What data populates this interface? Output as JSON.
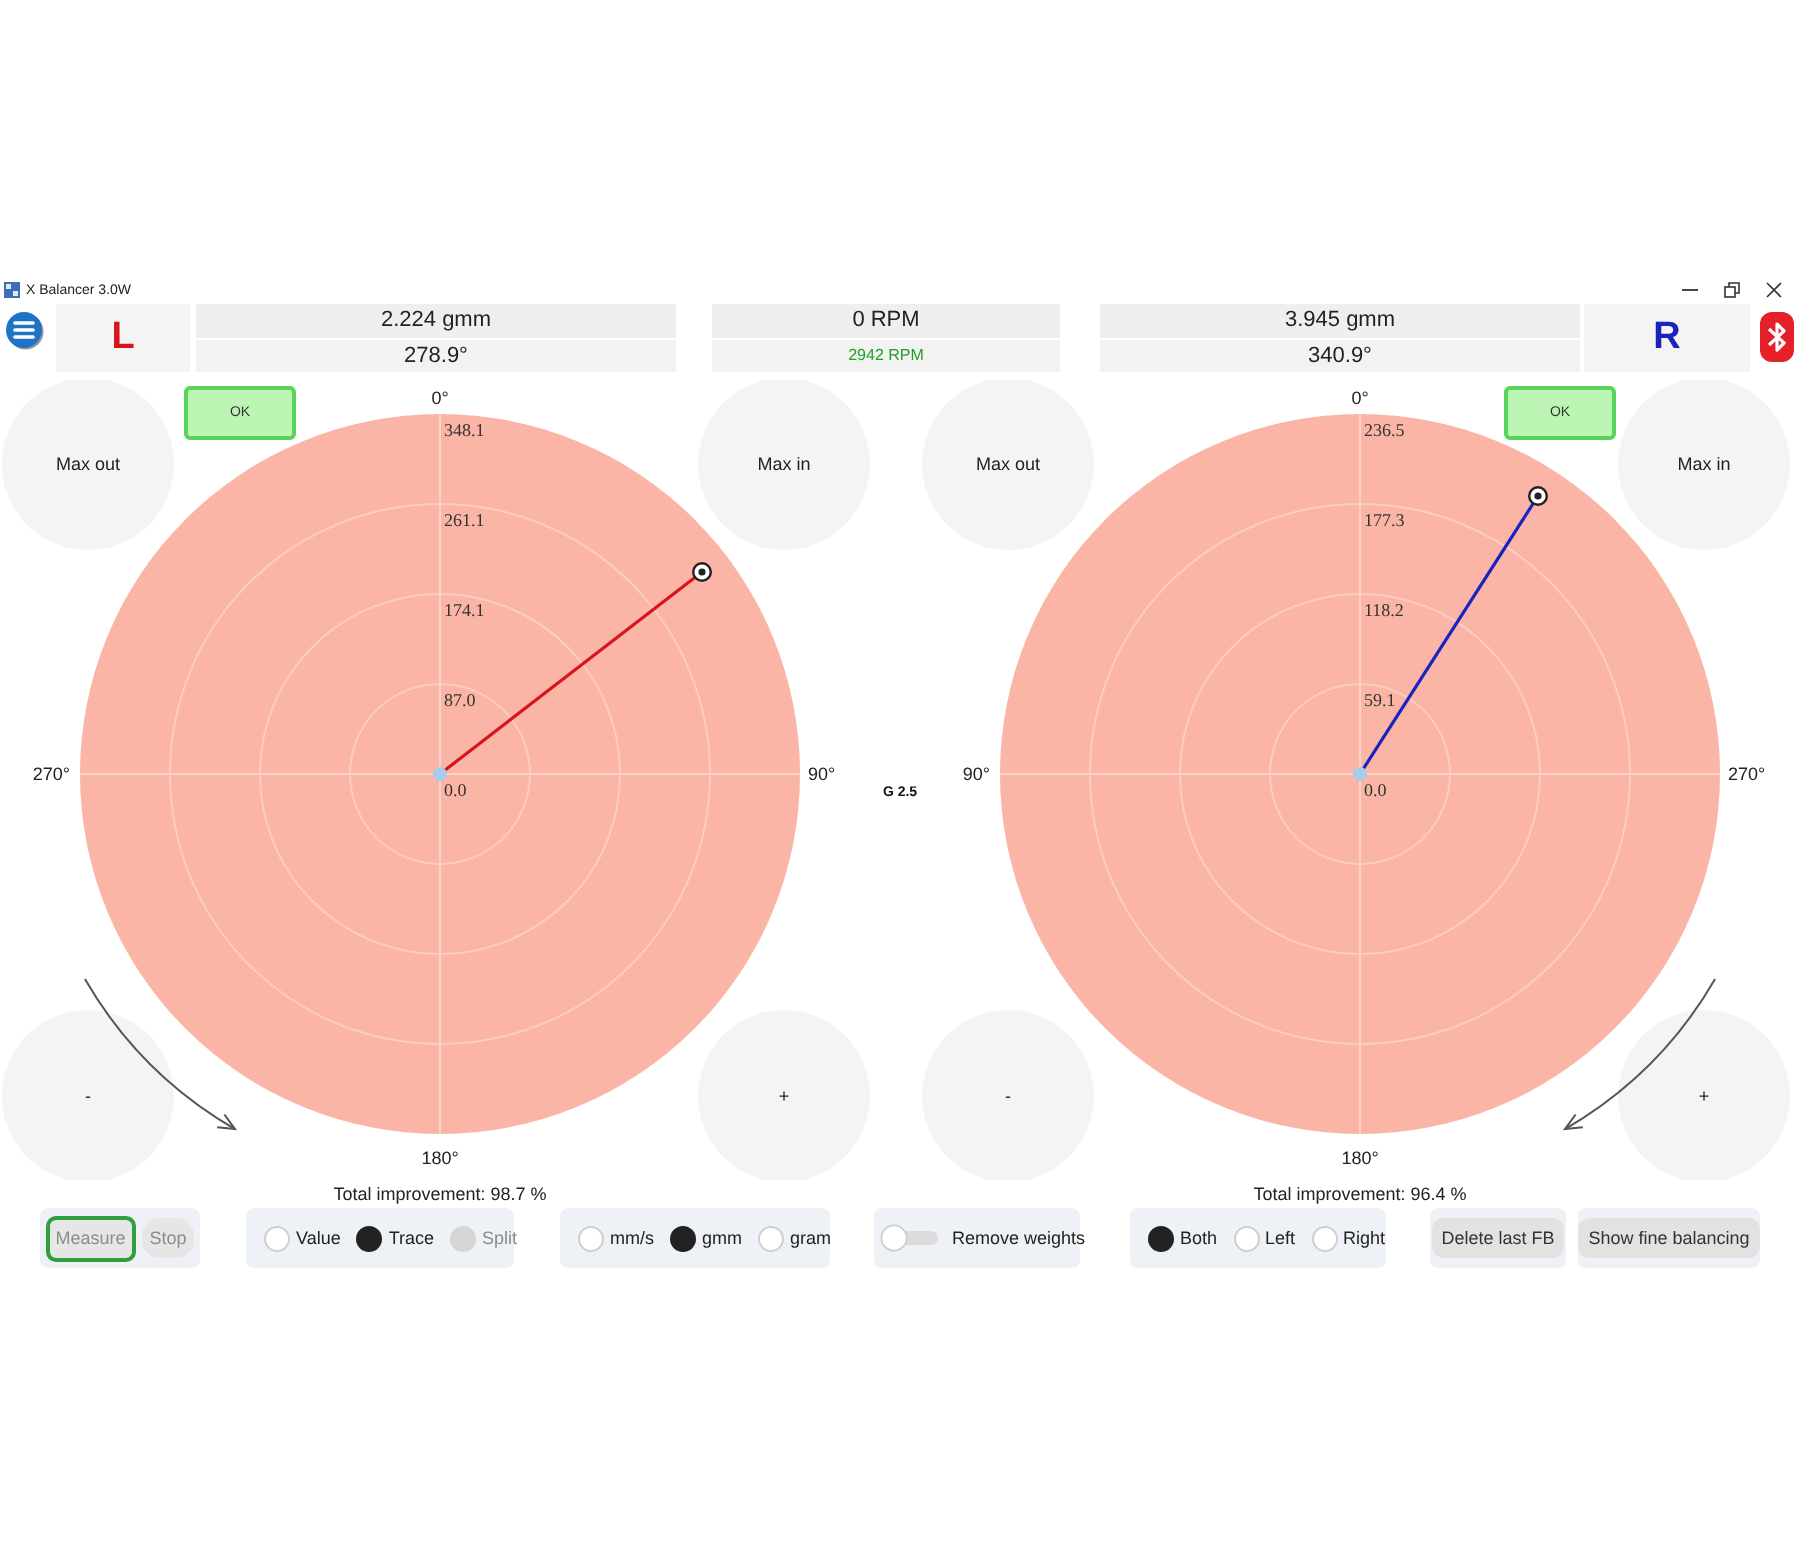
{
  "window": {
    "title": "X Balancer 3.0W"
  },
  "speed": {
    "rpm": "0 RPM",
    "target_rpm": "2942 RPM"
  },
  "sides": [
    {
      "label": "L",
      "color": "#d8141c",
      "amount": "2.224 gmm",
      "angle": "278.9°",
      "ok_button": "OK",
      "corner_buttons": [
        "Max out",
        "Max in",
        "-",
        "+"
      ],
      "angle_labels": {
        "top": "0°",
        "left": "270°",
        "right": "90°",
        "bottom": "180°"
      },
      "ring_labels": [
        "348.1",
        "261.1",
        "174.1",
        "87.0",
        "0.0"
      ],
      "rotation_arrow": {
        "kind": "counterclockwise"
      },
      "total_improvement": "Total improvement: 98.7 %"
    },
    {
      "label": "R",
      "color": "#1a22c0",
      "amount": "3.945 gmm",
      "angle": "340.9°",
      "ok_button": "OK",
      "corner_buttons": [
        "Max out",
        "Max in",
        "-",
        "+"
      ],
      "angle_labels": {
        "top": "0°",
        "left": "90°",
        "right": "270°",
        "bottom": "180°"
      },
      "ring_labels": [
        "236.5",
        "177.3",
        "118.2",
        "59.1",
        "0.0"
      ],
      "rotation_arrow": {
        "kind": "clockwise"
      },
      "total_improvement": "Total improvement: 96.4 %"
    }
  ],
  "balance_grade": "G 2.5",
  "controls": [
    {
      "kind": "buttons",
      "items": [
        {
          "label": "Measure",
          "disabled": true,
          "focused": true
        },
        {
          "label": "Stop",
          "disabled": true,
          "focused": false
        }
      ]
    },
    {
      "kind": "radios",
      "items": [
        {
          "label": "Value",
          "selected": false,
          "disabled": false
        },
        {
          "label": "Trace",
          "selected": true,
          "disabled": false
        },
        {
          "label": "Split",
          "selected": false,
          "disabled": true
        }
      ]
    },
    {
      "kind": "radios",
      "items": [
        {
          "label": "mm/s",
          "selected": false,
          "disabled": false
        },
        {
          "label": "gmm",
          "selected": true,
          "disabled": false
        },
        {
          "label": "gram",
          "selected": false,
          "disabled": false
        }
      ]
    },
    {
      "kind": "switch",
      "label": "Remove weights",
      "on": false
    },
    {
      "kind": "radios",
      "items": [
        {
          "label": "Both",
          "selected": true,
          "disabled": false
        },
        {
          "label": "Left",
          "selected": false,
          "disabled": false
        },
        {
          "label": "Right",
          "selected": false,
          "disabled": false
        }
      ]
    },
    {
      "kind": "buttons",
      "items": [
        {
          "label": "Delete last FB",
          "disabled": false,
          "focused": false
        }
      ]
    },
    {
      "kind": "buttons",
      "items": [
        {
          "label": "Show fine balancing",
          "disabled": false,
          "focused": false
        }
      ]
    }
  ]
}
